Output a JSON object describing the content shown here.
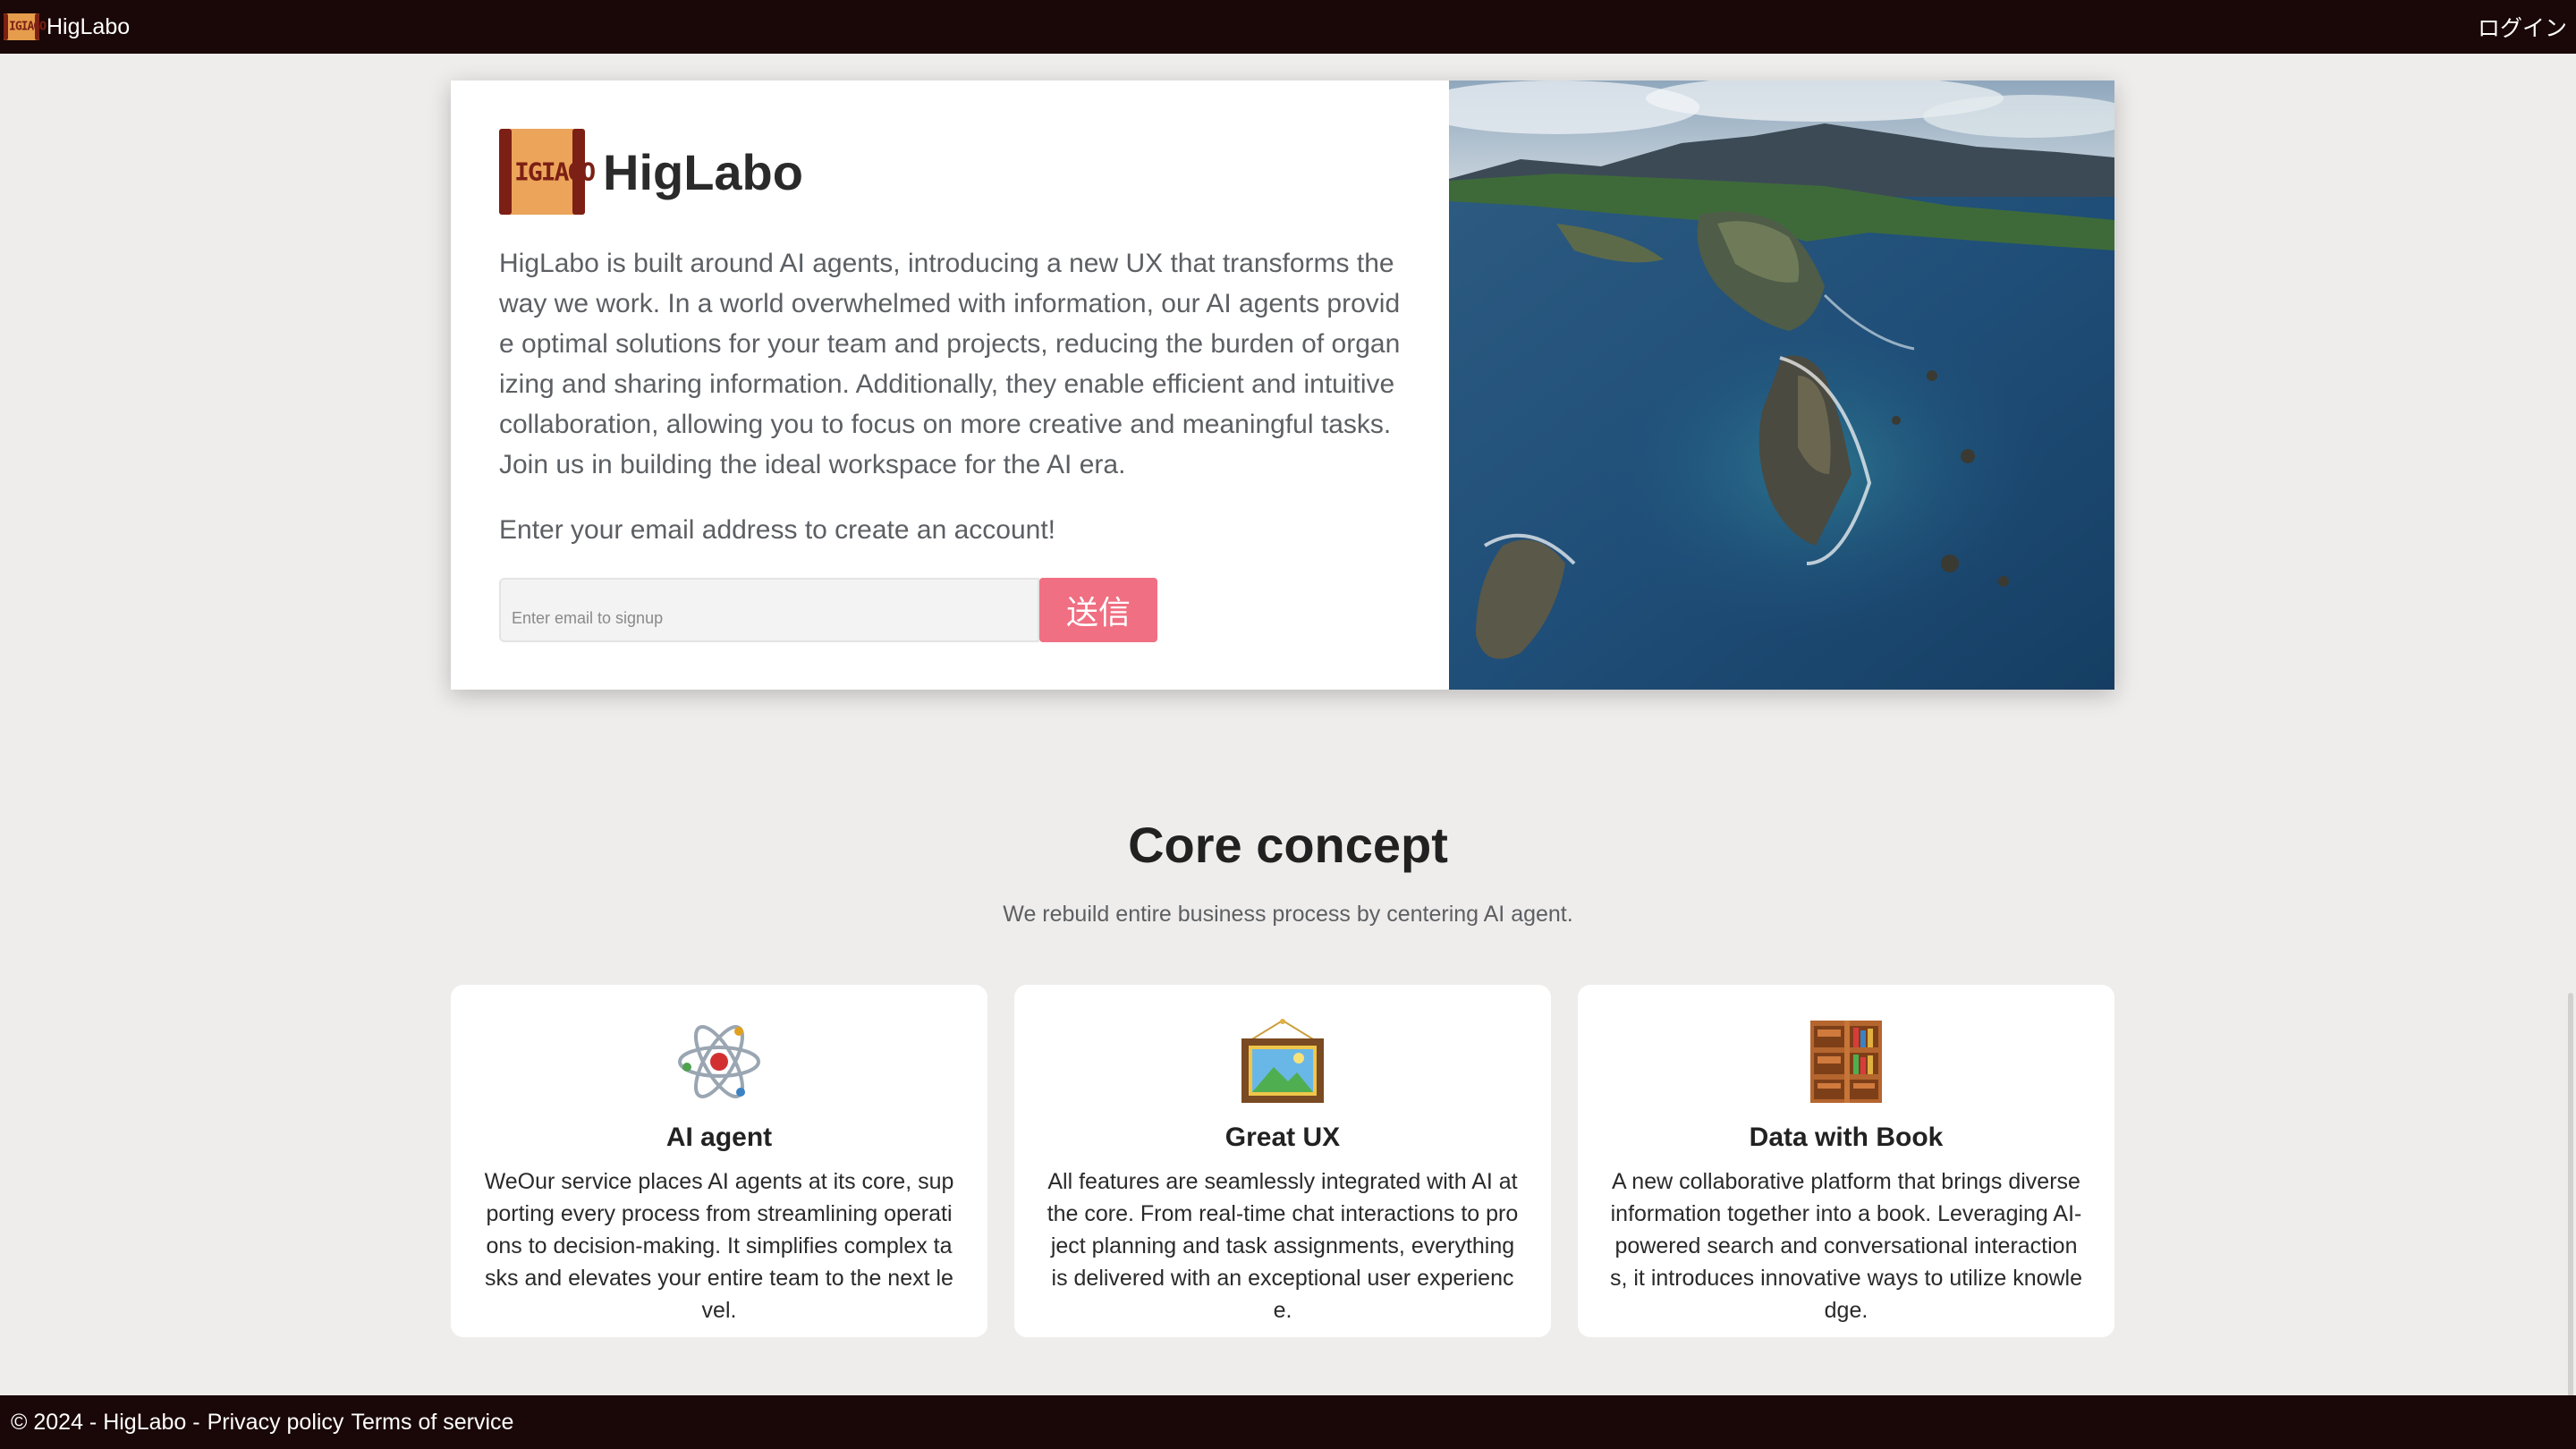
{
  "topbar": {
    "brand_name": "HigLabo",
    "login_label": "ログイン"
  },
  "logo": {
    "glyphs": "IGIAGO"
  },
  "hero": {
    "title": "HigLabo",
    "description": "HigLabo is built around AI agents, introducing a new UX that transforms the way we work. In a world overwhelmed with information, our AI agents provide optimal solutions for your team and projects, reducing the burden of organizing and sharing information. Additionally, they enable efficient and intuitive collaboration, allowing you to focus on more creative and meaningful tasks. Join us in building the ideal workspace for the AI era.",
    "cta": "Enter your email address to create an account!",
    "email_placeholder": "Enter email to signup",
    "send_label": "送信"
  },
  "core": {
    "title": "Core concept",
    "subtitle": "We rebuild entire business process by centering AI agent.",
    "cards": [
      {
        "icon": "atom-icon",
        "title": "AI agent",
        "body": "WeOur service places AI agents at its core, supporting every process from streamlining operations to decision-making. It simplifies complex tasks and elevates your entire team to the next level."
      },
      {
        "icon": "framed-picture-icon",
        "title": "Great UX",
        "body": "All features are seamlessly integrated with AI at the core. From real-time chat interactions to project planning and task assignments, everything is delivered with an exceptional user experience."
      },
      {
        "icon": "bookshelf-icon",
        "title": "Data with Book",
        "body": "A new collaborative platform that brings diverse information together into a book. Leveraging AI-powered search and conversational interactions, it introduces innovative ways to utilize knowledge."
      }
    ]
  },
  "footer": {
    "copyright": "© 2024 - HigLabo -",
    "privacy": "Privacy policy",
    "terms": "Terms of service"
  },
  "colors": {
    "nav_bg": "#1a0707",
    "page_bg": "#efedeb",
    "send_button": "#f06f82",
    "logo_orange": "#e59d4c",
    "logo_dark_red": "#7c1f14"
  }
}
